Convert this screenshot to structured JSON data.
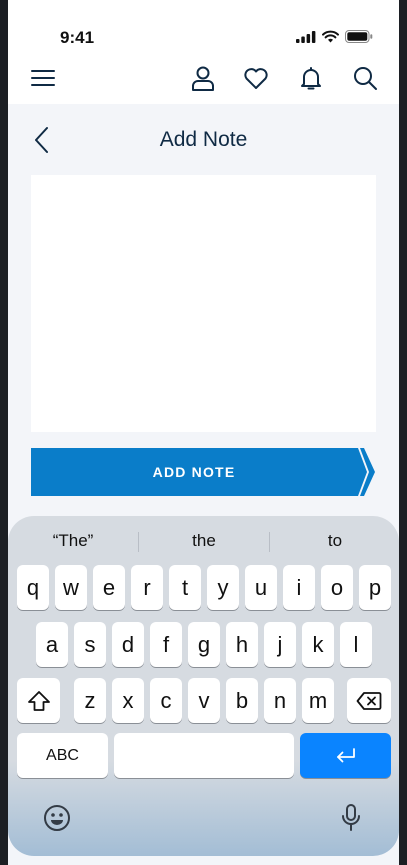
{
  "status_bar": {
    "time": "9:41"
  },
  "header": {
    "icons": [
      "menu-icon",
      "user-icon",
      "heart-icon",
      "bell-icon",
      "search-icon"
    ]
  },
  "page": {
    "title": "Add Note"
  },
  "note": {
    "placeholder": "",
    "value": ""
  },
  "add_button": {
    "label": "ADD NOTE"
  },
  "keyboard": {
    "suggestions": [
      "“The”",
      "the",
      "to"
    ],
    "row1": [
      "q",
      "w",
      "e",
      "r",
      "t",
      "y",
      "u",
      "i",
      "o",
      "p"
    ],
    "row2": [
      "a",
      "s",
      "d",
      "f",
      "g",
      "h",
      "j",
      "k",
      "l"
    ],
    "row3": [
      "z",
      "x",
      "c",
      "v",
      "b",
      "n",
      "m"
    ],
    "abc_label": "ABC"
  },
  "colors": {
    "accent": "#0a7dc9",
    "title": "#0f2a44",
    "return_key": "#0a84ff"
  }
}
